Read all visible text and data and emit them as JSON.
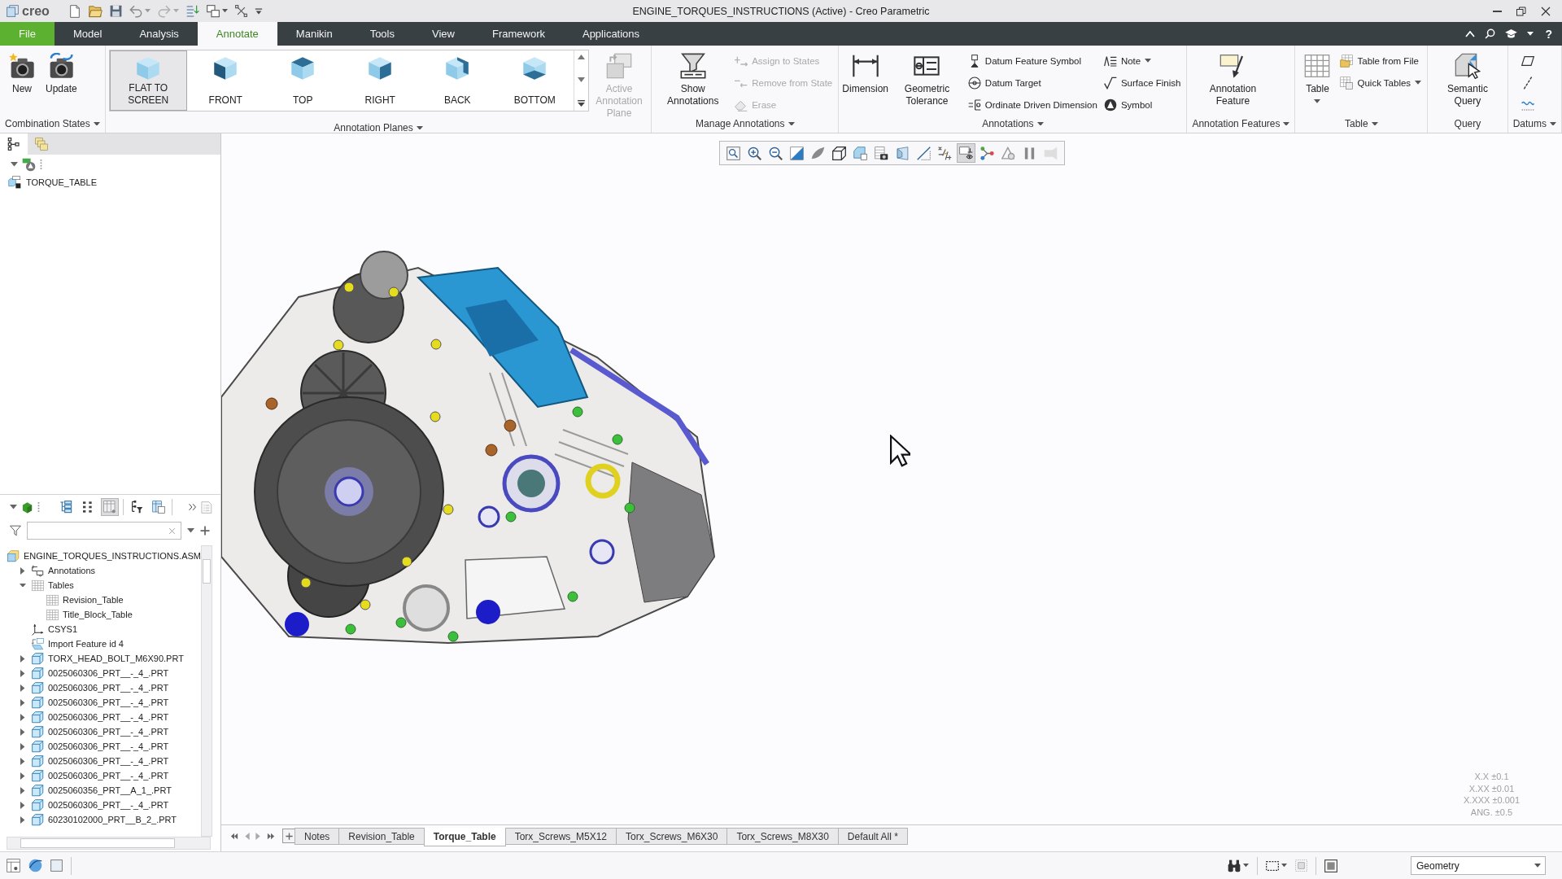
{
  "window": {
    "logo": "creo",
    "title": "ENGINE_TORQUES_INSTRUCTIONS (Active) - Creo Parametric"
  },
  "menu_tabs": [
    {
      "label": "File",
      "kind": "file",
      "selected": false
    },
    {
      "label": "Model",
      "kind": "tab",
      "selected": false
    },
    {
      "label": "Analysis",
      "kind": "tab",
      "selected": false
    },
    {
      "label": "Annotate",
      "kind": "tab",
      "selected": true
    },
    {
      "label": "Manikin",
      "kind": "tab",
      "selected": false
    },
    {
      "label": "Tools",
      "kind": "tab",
      "selected": false
    },
    {
      "label": "View",
      "kind": "tab",
      "selected": false
    },
    {
      "label": "Framework",
      "kind": "tab",
      "selected": false
    },
    {
      "label": "Applications",
      "kind": "tab",
      "selected": false
    }
  ],
  "help_label": "?",
  "ribbon": {
    "groups": [
      {
        "label": "Combination States",
        "menu": true,
        "columns": [
          {
            "kind": "large",
            "label": "New",
            "disabled": false,
            "menu": false
          },
          {
            "kind": "large",
            "label": "Update",
            "disabled": false,
            "menu": false
          }
        ]
      },
      {
        "label": "Annotation Planes",
        "menu": true,
        "columns": [
          {
            "kind": "gallery",
            "items": [
              {
                "label": "FLAT TO SCREEN",
                "selected": true
              },
              {
                "label": "FRONT",
                "selected": false
              },
              {
                "label": "TOP",
                "selected": false
              },
              {
                "label": "RIGHT",
                "selected": false
              },
              {
                "label": "BACK",
                "selected": false
              },
              {
                "label": "BOTTOM",
                "selected": false
              }
            ]
          },
          {
            "kind": "large",
            "label": "Active Annotation Plane",
            "disabled": true,
            "menu": false
          }
        ]
      },
      {
        "label": "Manage Annotations",
        "menu": true,
        "columns": [
          {
            "kind": "large",
            "label": "Show Annotations",
            "disabled": false,
            "menu": false
          },
          {
            "kind": "stack",
            "items": [
              {
                "kind": "small",
                "label": "Assign to States",
                "disabled": true,
                "menu": false
              },
              {
                "kind": "small",
                "label": "Remove from State",
                "disabled": true,
                "menu": false
              },
              {
                "kind": "small",
                "label": "Erase",
                "disabled": true,
                "menu": false
              }
            ]
          }
        ]
      },
      {
        "label": "Annotations",
        "menu": true,
        "columns": [
          {
            "kind": "large",
            "label": "Dimension",
            "disabled": false,
            "menu": false
          },
          {
            "kind": "large",
            "label": "Geometric Tolerance",
            "disabled": false,
            "menu": false
          },
          {
            "kind": "stack",
            "items": [
              {
                "kind": "small",
                "label": "Datum Feature Symbol",
                "disabled": false,
                "menu": false
              },
              {
                "kind": "small",
                "label": "Datum Target",
                "disabled": false,
                "menu": false
              },
              {
                "kind": "small",
                "label": "Ordinate Driven Dimension",
                "disabled": false,
                "menu": false
              }
            ]
          },
          {
            "kind": "stack",
            "items": [
              {
                "kind": "small",
                "label": "Note",
                "disabled": false,
                "menu": true
              },
              {
                "kind": "small",
                "label": "Surface Finish",
                "disabled": false,
                "menu": false
              },
              {
                "kind": "small",
                "label": "Symbol",
                "disabled": false,
                "menu": false
              }
            ]
          }
        ]
      },
      {
        "label": "Annotation Features",
        "menu": true,
        "columns": [
          {
            "kind": "large",
            "label": "Annotation Feature",
            "disabled": false,
            "menu": false
          }
        ]
      },
      {
        "label": "Table",
        "menu": true,
        "columns": [
          {
            "kind": "large",
            "label": "Table",
            "disabled": false,
            "menu": true
          },
          {
            "kind": "stack",
            "items": [
              {
                "kind": "small",
                "label": "Table from File",
                "disabled": false,
                "menu": false
              },
              {
                "kind": "small",
                "label": "Quick Tables",
                "disabled": false,
                "menu": true
              }
            ]
          }
        ]
      },
      {
        "label": "Query",
        "menu": false,
        "columns": [
          {
            "kind": "large",
            "label": "Semantic Query",
            "disabled": false,
            "menu": false
          }
        ]
      },
      {
        "label": "Datums",
        "menu": true,
        "columns": [
          {
            "kind": "stack",
            "items": [
              {
                "kind": "icon",
                "disabled": false,
                "menu": false
              },
              {
                "kind": "icon",
                "disabled": false,
                "menu": false
              },
              {
                "kind": "icon",
                "disabled": false,
                "menu": false
              }
            ]
          }
        ]
      }
    ]
  },
  "graphics_toolbar": {
    "buttons": [
      {
        "pressed": false
      },
      {
        "pressed": false
      },
      {
        "pressed": false
      },
      {
        "pressed": false
      },
      {
        "pressed": false
      },
      {
        "pressed": false
      },
      {
        "pressed": false
      },
      {
        "pressed": false
      },
      {
        "pressed": false
      },
      {
        "pressed": false
      },
      {
        "pressed": false
      },
      {
        "pressed": true
      },
      {
        "pressed": false
      },
      {
        "pressed": false
      },
      {
        "pressed": false
      },
      {
        "pressed": false
      }
    ]
  },
  "navigator": {
    "tabs": [
      {
        "selected": true
      },
      {
        "selected": false
      }
    ],
    "items": [
      {
        "label": "TORQUE_TABLE"
      }
    ]
  },
  "model_tree": {
    "toolbar": [
      {
        "pressed": false
      },
      {
        "pressed": false
      },
      {
        "pressed": true
      },
      {
        "pressed": false
      },
      {
        "pressed": false
      }
    ],
    "items": [
      {
        "label": "ENGINE_TORQUES_INSTRUCTIONS.ASM",
        "kind": "assembly",
        "children": [
          {
            "label": "Annotations",
            "kind": "annotations",
            "expanded": false
          },
          {
            "label": "Tables",
            "kind": "tables",
            "expanded": true,
            "children": [
              {
                "label": "Revision_Table",
                "kind": "table"
              },
              {
                "label": "Title_Block_Table",
                "kind": "table"
              }
            ]
          },
          {
            "label": "CSYS1",
            "kind": "csys"
          },
          {
            "label": "Import Feature id 4",
            "kind": "import"
          },
          {
            "label": "TORX_HEAD_BOLT_M6X90.PRT",
            "kind": "part",
            "expanded": false
          },
          {
            "label": "0025060306_PRT__-_4_.PRT",
            "kind": "part",
            "expanded": false
          },
          {
            "label": "0025060306_PRT__-_4_.PRT",
            "kind": "part",
            "expanded": false
          },
          {
            "label": "0025060306_PRT__-_4_.PRT",
            "kind": "part",
            "expanded": false
          },
          {
            "label": "0025060306_PRT__-_4_.PRT",
            "kind": "part",
            "expanded": false
          },
          {
            "label": "0025060306_PRT__-_4_.PRT",
            "kind": "part",
            "expanded": false
          },
          {
            "label": "0025060306_PRT__-_4_.PRT",
            "kind": "part",
            "expanded": false
          },
          {
            "label": "0025060306_PRT__-_4_.PRT",
            "kind": "part",
            "expanded": false
          },
          {
            "label": "0025060306_PRT__-_4_.PRT",
            "kind": "part",
            "expanded": false
          },
          {
            "label": "0025060356_PRT__A_1_.PRT",
            "kind": "part",
            "expanded": false
          },
          {
            "label": "0025060306_PRT__-_4_.PRT",
            "kind": "part",
            "expanded": false
          },
          {
            "label": "60230102000_PRT__B_2_.PRT",
            "kind": "part",
            "expanded": false
          }
        ]
      }
    ]
  },
  "sheet_tabs": [
    {
      "label": "Notes",
      "selected": false
    },
    {
      "label": "Revision_Table",
      "selected": false
    },
    {
      "label": "Torque_Table",
      "selected": true
    },
    {
      "label": "Torx_Screws_M5X12",
      "selected": false
    },
    {
      "label": "Torx_Screws_M6X30",
      "selected": false
    },
    {
      "label": "Torx_Screws_M8X30",
      "selected": false
    },
    {
      "label": "Default All *",
      "selected": false
    }
  ],
  "tolerance_note": [
    "X.X ±0.1",
    "X.XX ±0.01",
    "X.XXX ±0.001",
    "ANG. ±0.5"
  ],
  "status_bar": {
    "selection_filter": {
      "value": "Geometry"
    }
  }
}
